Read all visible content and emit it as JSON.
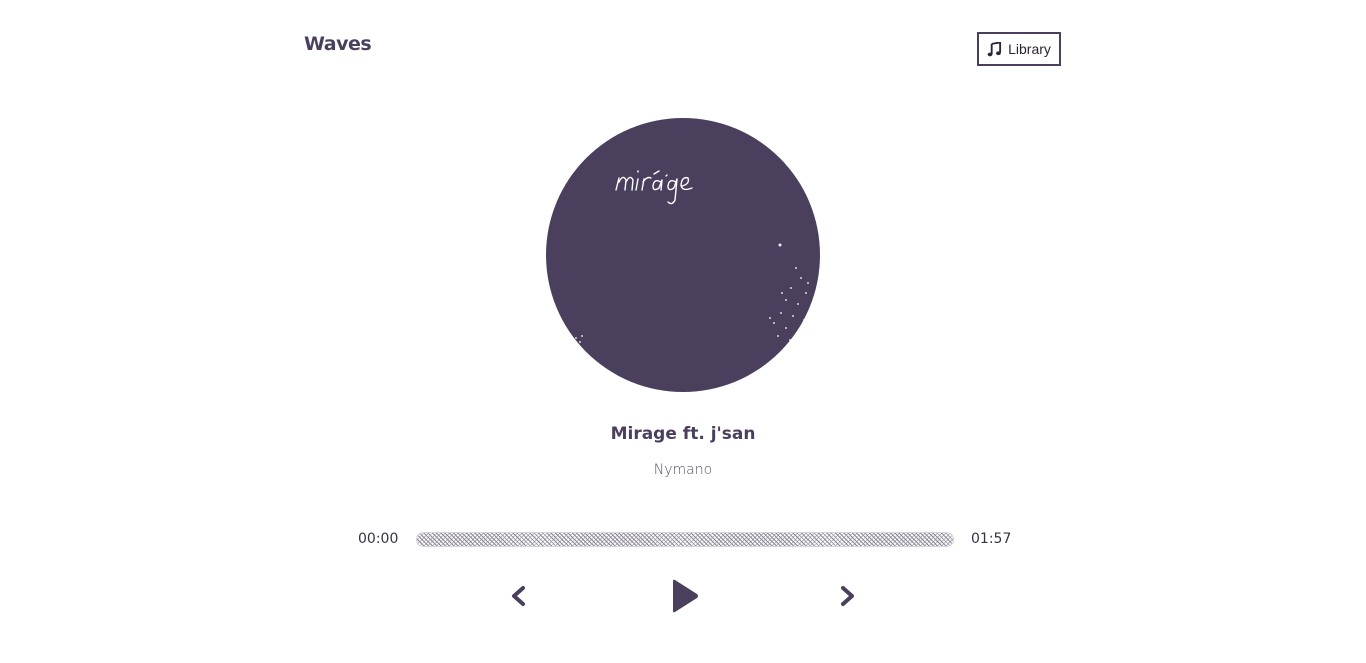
{
  "header": {
    "logo": "Waves",
    "library_button": {
      "label": "Library",
      "icon": "music-note-icon"
    }
  },
  "album": {
    "cover_text": "mirage",
    "cover_color": "#4b3f5e"
  },
  "song": {
    "title": "Mirage ft. j'san",
    "artist": "Nymano"
  },
  "player": {
    "current_time": "00:00",
    "total_time": "01:57",
    "progress_percent": 0
  },
  "controls": {
    "previous_icon": "chevron-left-icon",
    "play_icon": "play-icon",
    "next_icon": "chevron-right-icon"
  },
  "colors": {
    "accent": "#4b3f5e",
    "background": "#ffffff"
  }
}
